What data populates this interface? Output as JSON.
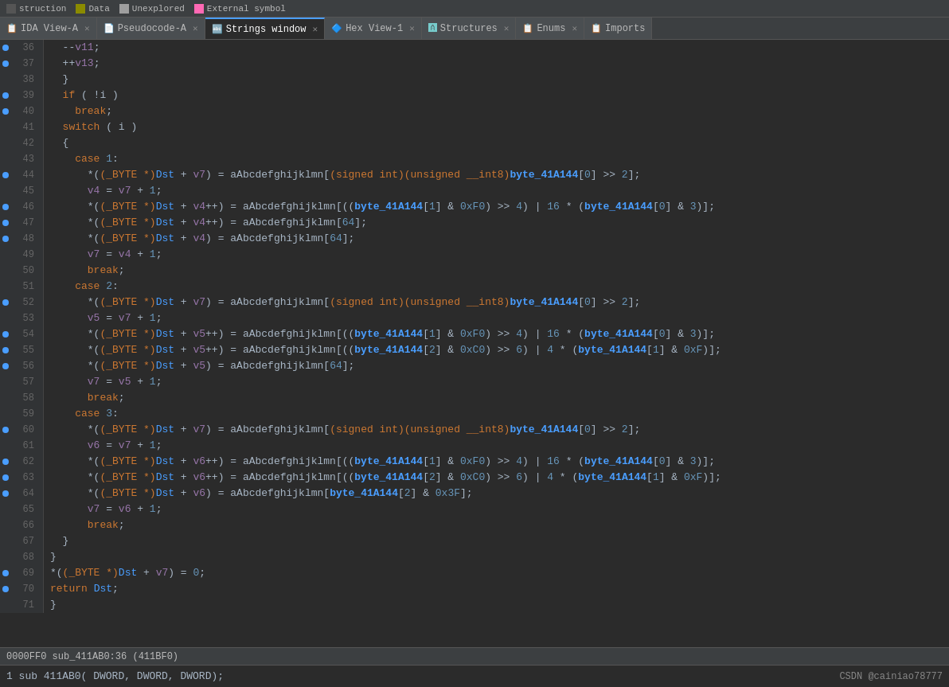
{
  "legend": {
    "items": [
      {
        "label": "struction",
        "color": "#555555",
        "shape": "rect"
      },
      {
        "label": "Data",
        "color": "#8b8b00",
        "shape": "rect"
      },
      {
        "label": "Unexplored",
        "color": "#7a7a7a",
        "shape": "rect"
      },
      {
        "label": "External symbol",
        "color": "#ff69b4",
        "shape": "rect"
      }
    ]
  },
  "tabs": [
    {
      "id": "ida-view",
      "icon": "📋",
      "label": "IDA View-A",
      "closable": true,
      "active": false
    },
    {
      "id": "pseudocode",
      "icon": "📄",
      "label": "Pseudocode-A",
      "closable": true,
      "active": false
    },
    {
      "id": "strings",
      "icon": "🔤",
      "label": "Strings window",
      "closable": true,
      "active": true
    },
    {
      "id": "hex-view",
      "icon": "🔷",
      "label": "Hex View-1",
      "closable": true,
      "active": false
    },
    {
      "id": "structures",
      "icon": "🅰",
      "label": "Structures",
      "closable": true,
      "active": false
    },
    {
      "id": "enums",
      "icon": "📋",
      "label": "Enums",
      "closable": true,
      "active": false
    },
    {
      "id": "imports",
      "icon": "📋",
      "label": "Imports",
      "closable": false,
      "active": false
    }
  ],
  "status_bar": "0000FF0  sub_411AB0:36 (411BF0)",
  "bottom_bar": {
    "text": "1 sub 411AB0( DWORD,  DWORD,  DWORD);",
    "csdn": "CSDN @cainiao78777"
  },
  "code_lines": [
    {
      "num": 36,
      "dot": true,
      "content": "  --v11;"
    },
    {
      "num": 37,
      "dot": true,
      "content": "  ++v13;"
    },
    {
      "num": 38,
      "dot": false,
      "content": "  }"
    },
    {
      "num": 39,
      "dot": true,
      "content": "  if ( !i )"
    },
    {
      "num": 40,
      "dot": true,
      "content": "    break;"
    },
    {
      "num": 41,
      "dot": false,
      "content": "  switch ( i )"
    },
    {
      "num": 42,
      "dot": false,
      "content": "  {"
    },
    {
      "num": 43,
      "dot": false,
      "content": "    case 1:"
    },
    {
      "num": 44,
      "dot": true,
      "content": "      *((_BYTE *)Dst + v7) = aAbcdefghijklmn[(signed int)(unsigned __int8)byte_41A144[0] >> 2];"
    },
    {
      "num": 45,
      "dot": false,
      "content": "      v4 = v7 + 1;"
    },
    {
      "num": 46,
      "dot": true,
      "content": "      *((_BYTE *)Dst + v4++) = aAbcdefghijklmn[((byte_41A144[1] & 0xF0) >> 4) | 16 * (byte_41A144[0] & 3)];"
    },
    {
      "num": 47,
      "dot": true,
      "content": "      *((_BYTE *)Dst + v4++) = aAbcdefghijklmn[64];"
    },
    {
      "num": 48,
      "dot": true,
      "content": "      *((_BYTE *)Dst + v4) = aAbcdefghijklmn[64];"
    },
    {
      "num": 49,
      "dot": false,
      "content": "      v7 = v4 + 1;"
    },
    {
      "num": 50,
      "dot": false,
      "content": "      break;"
    },
    {
      "num": 51,
      "dot": false,
      "content": "    case 2:"
    },
    {
      "num": 52,
      "dot": true,
      "content": "      *((_BYTE *)Dst + v7) = aAbcdefghijklmn[(signed int)(unsigned __int8)byte_41A144[0] >> 2];"
    },
    {
      "num": 53,
      "dot": false,
      "content": "      v5 = v7 + 1;"
    },
    {
      "num": 54,
      "dot": true,
      "content": "      *((_BYTE *)Dst + v5++) = aAbcdefghijklmn[((byte_41A144[1] & 0xF0) >> 4) | 16 * (byte_41A144[0] & 3)];"
    },
    {
      "num": 55,
      "dot": true,
      "content": "      *((_BYTE *)Dst + v5++) = aAbcdefghijklmn[((byte_41A144[2] & 0xC0) >> 6) | 4 * (byte_41A144[1] & 0xF)];"
    },
    {
      "num": 56,
      "dot": true,
      "content": "      *((_BYTE *)Dst + v5) = aAbcdefghijklmn[64];"
    },
    {
      "num": 57,
      "dot": false,
      "content": "      v7 = v5 + 1;"
    },
    {
      "num": 58,
      "dot": false,
      "content": "      break;"
    },
    {
      "num": 59,
      "dot": false,
      "content": "    case 3:"
    },
    {
      "num": 60,
      "dot": true,
      "content": "      *((_BYTE *)Dst + v7) = aAbcdefghijklmn[(signed int)(unsigned __int8)byte_41A144[0] >> 2];"
    },
    {
      "num": 61,
      "dot": false,
      "content": "      v6 = v7 + 1;"
    },
    {
      "num": 62,
      "dot": true,
      "content": "      *((_BYTE *)Dst + v6++) = aAbcdefghijklmn[((byte_41A144[1] & 0xF0) >> 4) | 16 * (byte_41A144[0] & 3)];"
    },
    {
      "num": 63,
      "dot": true,
      "content": "      *((_BYTE *)Dst + v6++) = aAbcdefghijklmn[((byte_41A144[2] & 0xC0) >> 6) | 4 * (byte_41A144[1] & 0xF)];"
    },
    {
      "num": 64,
      "dot": true,
      "content": "      *((_BYTE *)Dst + v6) = aAbcdefghijklmn[byte_41A144[2] & 0x3F];"
    },
    {
      "num": 65,
      "dot": false,
      "content": "      v7 = v6 + 1;"
    },
    {
      "num": 66,
      "dot": false,
      "content": "      break;"
    },
    {
      "num": 67,
      "dot": false,
      "content": "  }"
    },
    {
      "num": 68,
      "dot": false,
      "content": "}"
    },
    {
      "num": 69,
      "dot": true,
      "content": "*((_BYTE *)Dst + v7) = 0;"
    },
    {
      "num": 70,
      "dot": true,
      "content": "return Dst;"
    },
    {
      "num": 71,
      "dot": false,
      "content": "}"
    }
  ]
}
